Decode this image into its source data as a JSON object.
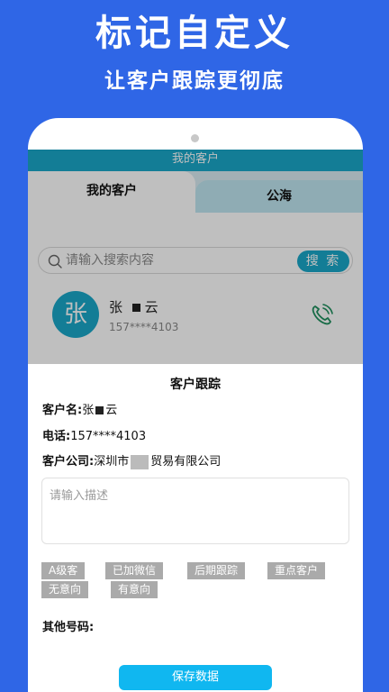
{
  "promo": {
    "title": "标记自定义",
    "subtitle": "让客户跟踪更彻底"
  },
  "app": {
    "header_title": "我的客户",
    "tabs": [
      {
        "label": "我的客户",
        "active": true
      },
      {
        "label": "公海",
        "active": false
      }
    ],
    "search": {
      "placeholder": "请输入搜索内容",
      "button_label": "搜 索"
    },
    "customer": {
      "avatar_char": "张",
      "name_first": "张",
      "name_last": "云",
      "phone": "157****4103"
    }
  },
  "sheet": {
    "title": "客户跟踪",
    "name_label": "客户名:",
    "name_first": "张",
    "name_last": "云",
    "phone_label": "电话:",
    "phone_value": "157****4103",
    "company_label": "客户公司:",
    "company_prefix": "深圳市",
    "company_suffix": "贸易有限公司",
    "description_placeholder": "请输入描述",
    "tags": [
      "A级客",
      "已加微信",
      "后期跟踪",
      "重点客户",
      "无意向",
      "有意向"
    ],
    "other_numbers_label": "其他号码:",
    "save_label": "保存数据"
  },
  "colors": {
    "background": "#2f66e6",
    "accent": "#1aa7c9",
    "save_button": "#10b7f0",
    "tag": "#aaaaaa"
  }
}
